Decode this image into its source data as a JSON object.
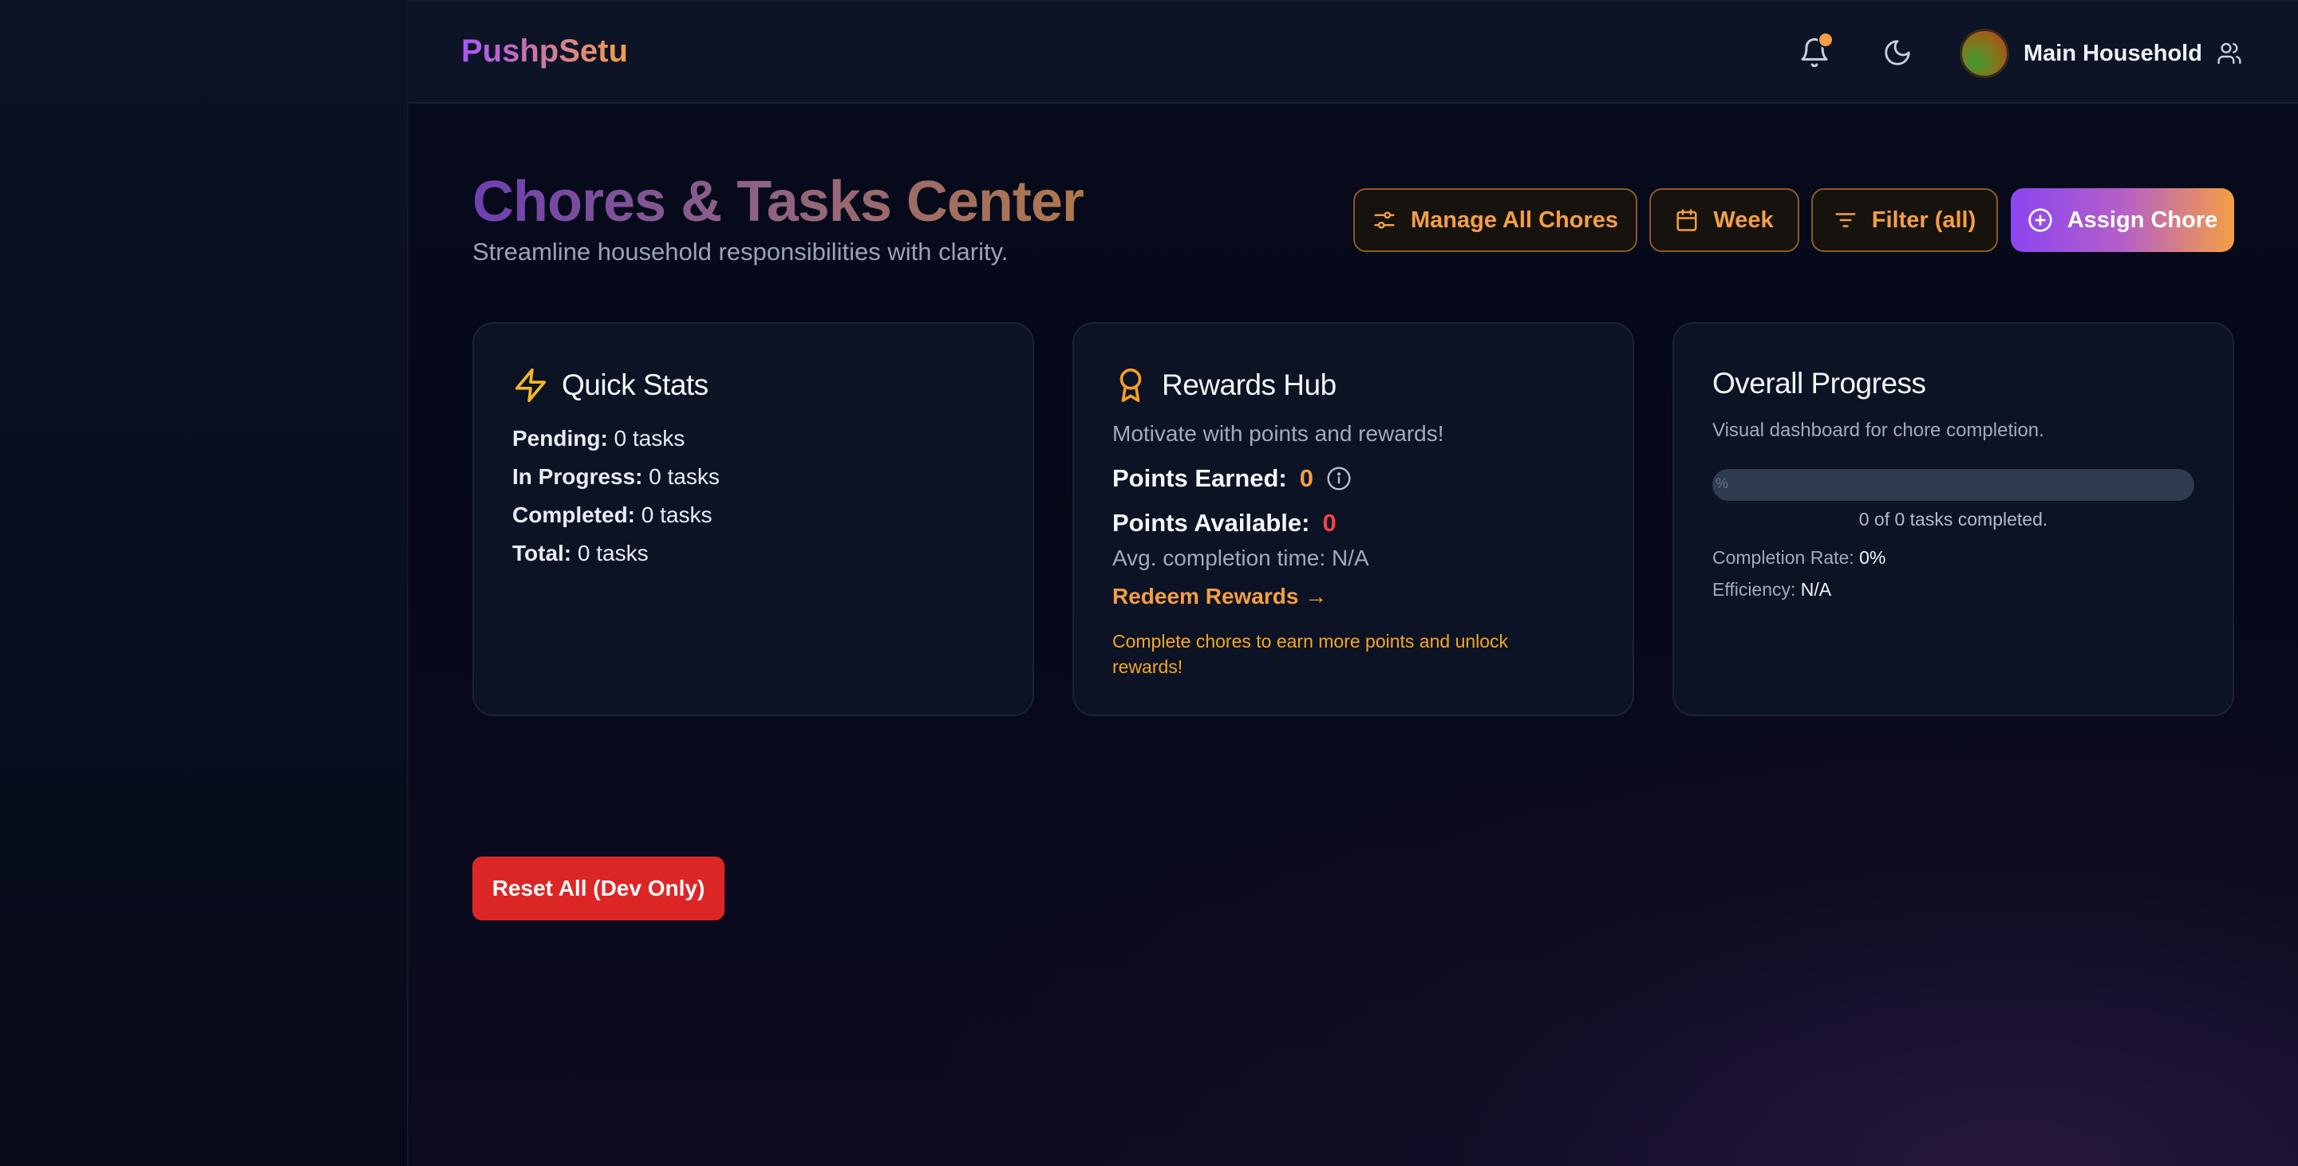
{
  "app": {
    "brand": "PushpSetu"
  },
  "header": {
    "notification_dot_color": "#f59e45",
    "household_name": "Main Household"
  },
  "page": {
    "title": "Chores & Tasks Center",
    "subtitle": "Streamline household responsibilities with clarity."
  },
  "toolbar": {
    "manage_label": "Manage All Chores",
    "week_label": "Week",
    "filter_label": "Filter (all)",
    "assign_label": "Assign Chore"
  },
  "quick_stats": {
    "title": "Quick Stats",
    "rows": [
      {
        "label": "Pending:",
        "value": "0 tasks"
      },
      {
        "label": "In Progress:",
        "value": "0 tasks"
      },
      {
        "label": "Completed:",
        "value": "0 tasks"
      },
      {
        "label": "Total:",
        "value": "0 tasks"
      }
    ]
  },
  "rewards": {
    "title": "Rewards Hub",
    "subtitle": "Motivate with points and rewards!",
    "points_earned_label": "Points Earned:",
    "points_earned_value": "0",
    "points_available_label": "Points Available:",
    "points_available_value": "0",
    "avg_time": "Avg. completion time: N/A",
    "redeem_link": "Redeem Rewards →",
    "note": "Complete chores to earn more points and unlock rewards!"
  },
  "progress": {
    "title": "Overall Progress",
    "subtitle": "Visual dashboard for chore completion.",
    "fraction": 0,
    "bar_label": "%",
    "count_text": "0 of 0 tasks completed.",
    "completion_rate_label": "Completion Rate:",
    "completion_rate_value": "0%",
    "efficiency_label": "Efficiency:",
    "efficiency_value": "N/A"
  },
  "dev": {
    "reset_label": "Reset All (Dev Only)"
  },
  "colors": {
    "accent_orange": "#f59e45",
    "accent_purple": "#a855f7",
    "danger": "#dc2626"
  },
  "icons": [
    "bell-icon",
    "moon-icon",
    "users-icon",
    "sliders-icon",
    "calendar-icon",
    "filter-icon",
    "plus-circle-icon",
    "bolt-icon",
    "award-icon",
    "info-icon"
  ]
}
